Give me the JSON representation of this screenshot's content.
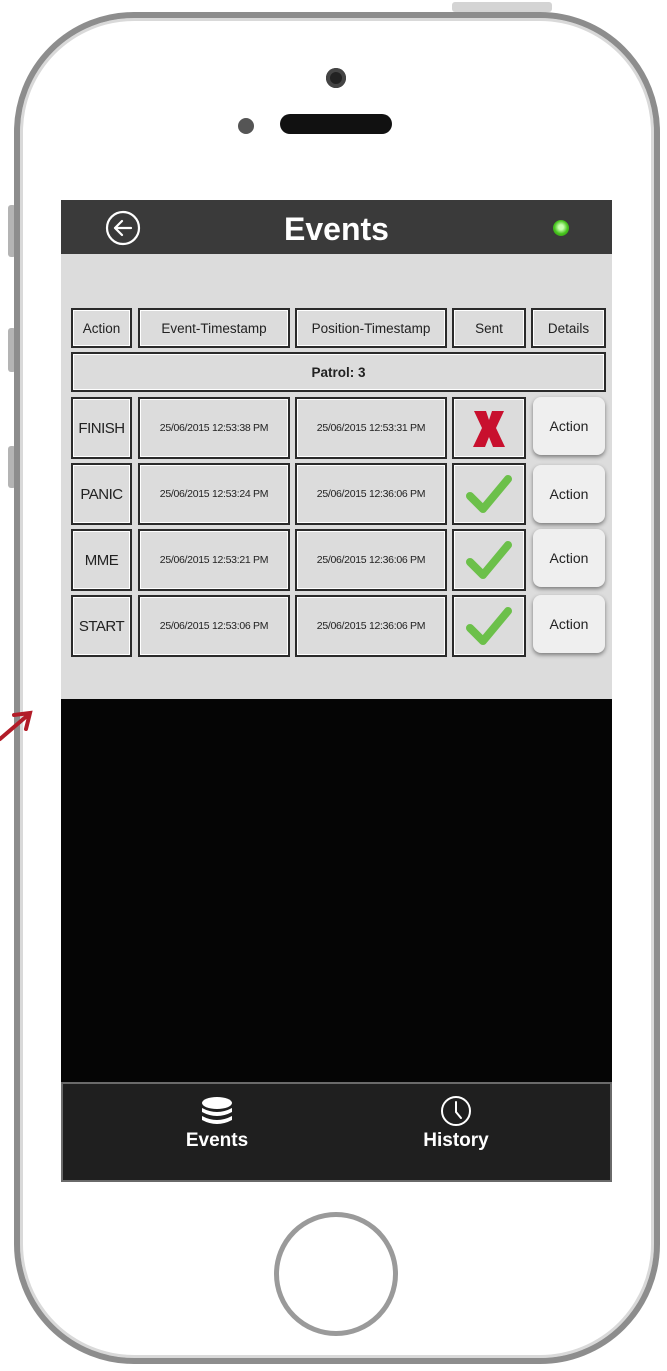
{
  "header": {
    "title": "Events",
    "back": "back-arrow-icon",
    "status": "online"
  },
  "table": {
    "headers": [
      "Action",
      "Event-Timestamp",
      "Position-Timestamp",
      "Sent",
      "Details"
    ],
    "group_label": "Patrol: 3",
    "rows": [
      {
        "action": "FINISH",
        "event_ts": "25/06/2015 12:53:38 PM",
        "position_ts": "25/06/2015 12:53:31 PM",
        "sent": false,
        "details_label": "Action"
      },
      {
        "action": "PANIC",
        "event_ts": "25/06/2015 12:53:24 PM",
        "position_ts": "25/06/2015 12:36:06 PM",
        "sent": true,
        "details_label": "Action"
      },
      {
        "action": "MME",
        "event_ts": "25/06/2015 12:53:21 PM",
        "position_ts": "25/06/2015 12:36:06 PM",
        "sent": true,
        "details_label": "Action"
      },
      {
        "action": "START",
        "event_ts": "25/06/2015 12:53:06 PM",
        "position_ts": "25/06/2015 12:36:06 PM",
        "sent": true,
        "details_label": "Action"
      }
    ]
  },
  "tabs": [
    {
      "label": "Events",
      "icon": "stack-icon"
    },
    {
      "label": "History",
      "icon": "clock-icon"
    }
  ],
  "colors": {
    "sent_ok": "#6cc04a",
    "sent_fail": "#c8102e",
    "status_led": "#47c41d"
  }
}
